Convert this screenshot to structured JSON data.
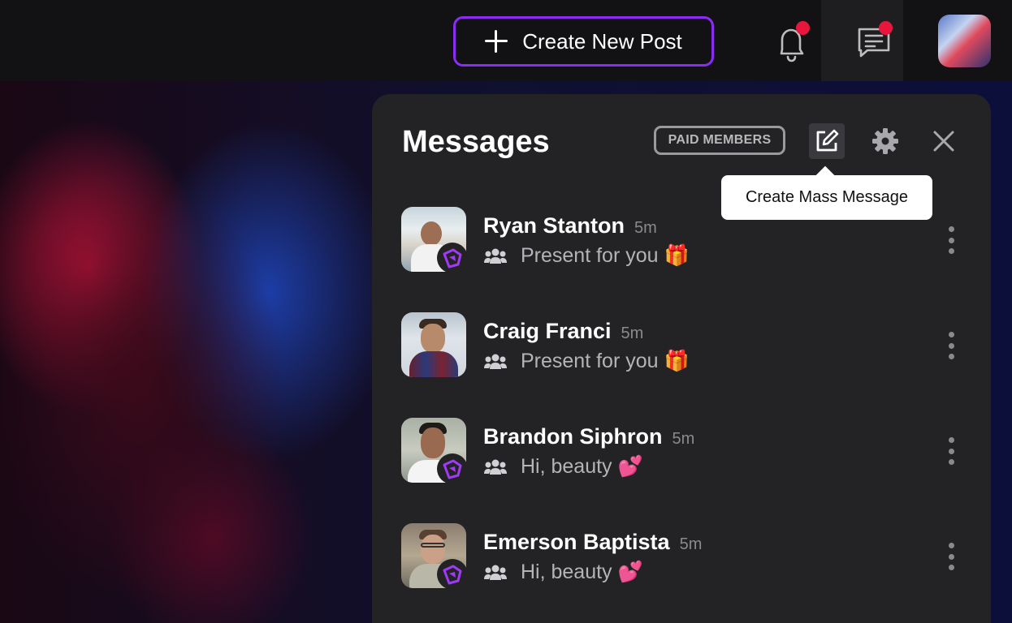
{
  "topbar": {
    "create_post_label": "Create New Post",
    "notifications_has_unread": true,
    "messages_has_unread": true
  },
  "panel": {
    "title": "Messages",
    "filter_badge": "PAID MEMBERS",
    "tooltip": "Create Mass Message"
  },
  "messages": [
    {
      "name": "Ryan Stanton",
      "time": "5m",
      "preview": "Present for you",
      "emoji": "🎁",
      "verified": true
    },
    {
      "name": "Craig Franci",
      "time": "5m",
      "preview": "Present for you",
      "emoji": "🎁",
      "verified": false
    },
    {
      "name": "Brandon Siphron",
      "time": "5m",
      "preview": "Hi, beauty",
      "emoji": "💕",
      "verified": true
    },
    {
      "name": "Emerson Baptista",
      "time": "5m",
      "preview": "Hi, beauty",
      "emoji": "💕",
      "verified": true
    }
  ],
  "colors": {
    "accent": "#8b2cf5",
    "notification_dot": "#e8153c",
    "panel_bg": "#232325",
    "topbar_bg": "#121214"
  },
  "icons": [
    "plus-icon",
    "bell-icon",
    "chat-icon",
    "compose-icon",
    "gear-icon",
    "close-icon",
    "group-icon",
    "shield-icon",
    "kebab-icon"
  ]
}
